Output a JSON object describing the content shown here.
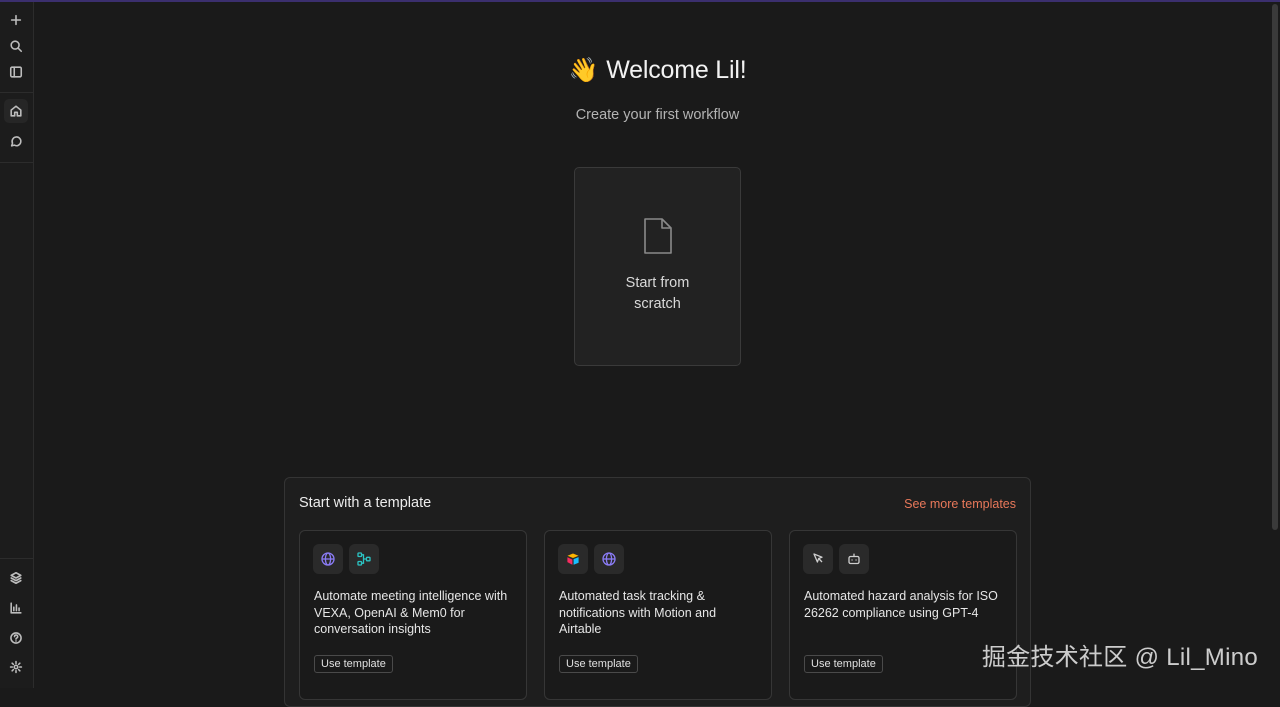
{
  "sidebar": {
    "top_items": [
      {
        "icon": "plus-icon"
      },
      {
        "icon": "search-icon"
      },
      {
        "icon": "panel-left-icon"
      }
    ],
    "nav_items": [
      {
        "icon": "home-icon",
        "active": true
      },
      {
        "icon": "chat-bubble-icon",
        "active": false
      }
    ],
    "bottom_items": [
      {
        "icon": "cube-stack-icon"
      },
      {
        "icon": "bar-chart-icon"
      },
      {
        "icon": "help-circle-icon"
      },
      {
        "icon": "settings-gear-icon"
      }
    ]
  },
  "main": {
    "welcome_emoji": "👋",
    "welcome_title": "Welcome Lil!",
    "subtitle": "Create your first workflow",
    "scratch_card": {
      "label": "Start from scratch",
      "icon": "file-icon"
    }
  },
  "templates": {
    "title": "Start with a template",
    "see_more": "See more templates",
    "cards": [
      {
        "icons": [
          "globe-icon",
          "workflow-nodes-icon"
        ],
        "description": "Automate meeting intelligence with VEXA, OpenAI & Mem0 for conversation insights",
        "button": "Use template"
      },
      {
        "icons": [
          "airtable-logo-icon",
          "globe-icon"
        ],
        "description": "Automated task tracking & notifications with Motion and Airtable",
        "button": "Use template"
      },
      {
        "icons": [
          "cursor-pointer-icon",
          "robot-icon"
        ],
        "description": "Automated hazard analysis for ISO 26262 compliance using GPT-4",
        "button": "Use template"
      }
    ]
  },
  "watermark": "掘金技术社区 @ Lil_Mino",
  "colors": {
    "background": "#1a1a1a",
    "accent_link": "#e8785a",
    "globe_icon": "#8b7cf6",
    "workflow_icon": "#2bc4c4"
  }
}
